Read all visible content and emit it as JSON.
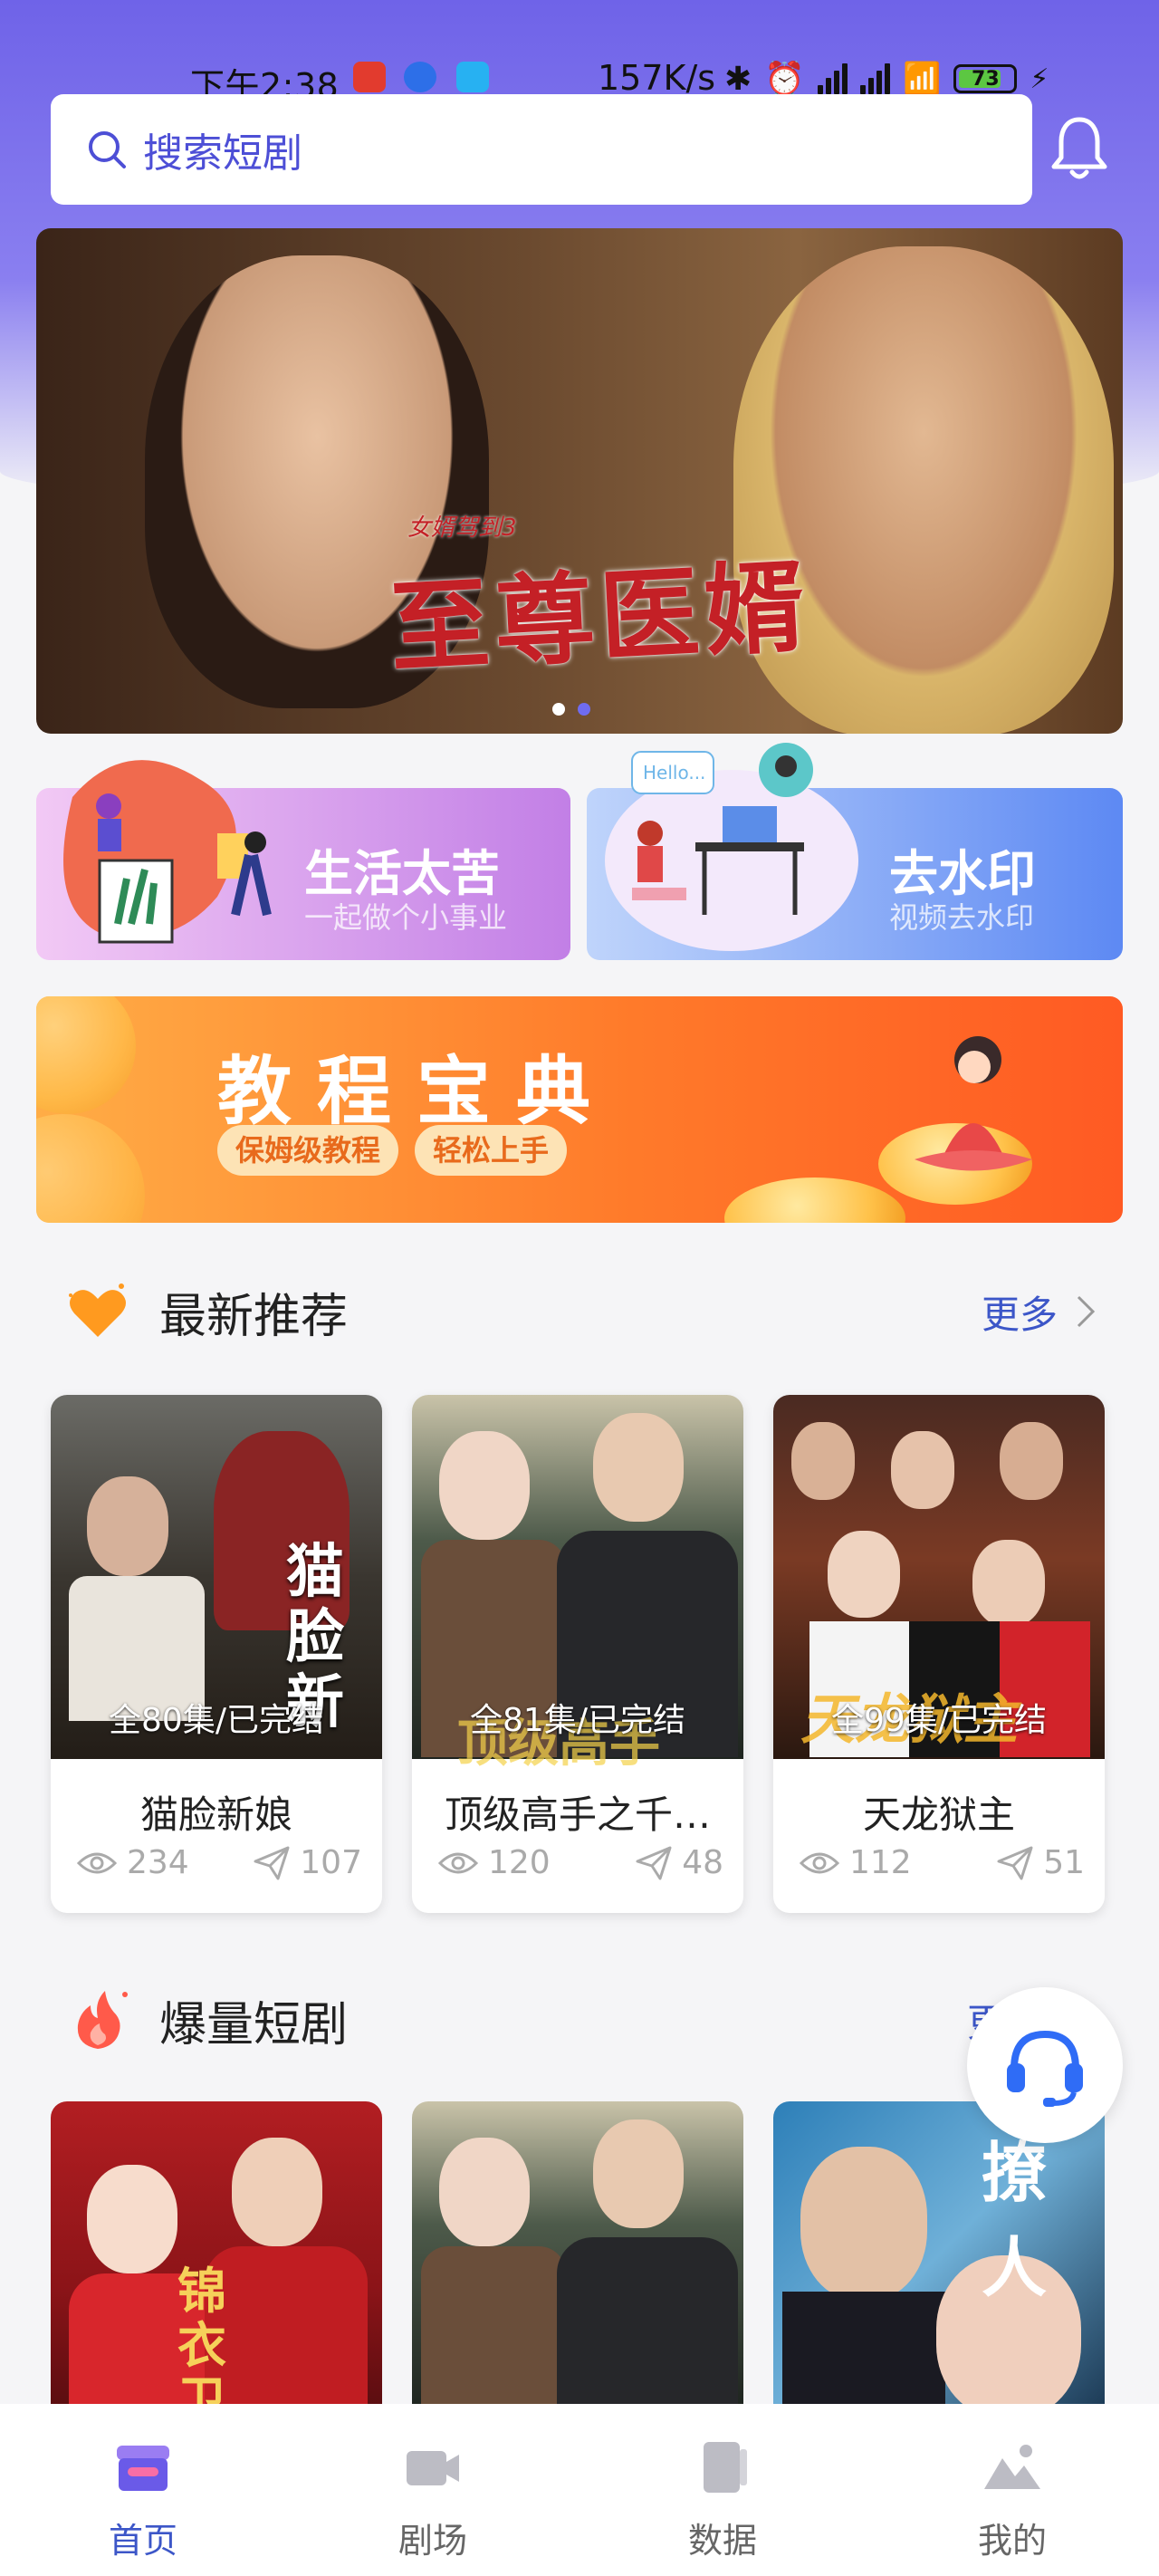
{
  "status_bar": {
    "time": "下午2:38",
    "net_speed": "157K/s",
    "battery": "73"
  },
  "search": {
    "placeholder": "搜索短剧"
  },
  "banner": {
    "title": "至尊医婿",
    "subtitle": "女婿驾到3",
    "active_dot": 1,
    "dot_count": 2
  },
  "features": [
    {
      "title": "生活太苦",
      "subtitle": "一起做个小事业"
    },
    {
      "title": "去水印",
      "subtitle": "视频去水印",
      "bubble": "Hello..."
    }
  ],
  "tutorial": {
    "title": "教程宝典",
    "tags": [
      "保姆级教程",
      "轻松上手"
    ]
  },
  "sections": {
    "latest": {
      "title": "最新推荐",
      "more": "更多"
    },
    "hot": {
      "title": "爆量短剧",
      "more": "更"
    }
  },
  "latest_dramas": [
    {
      "name": "猫脸新娘",
      "episodes": "全80集/已完结",
      "views": "234",
      "shares": "107",
      "poster_text": "猫脸新"
    },
    {
      "name": "顶级高手之千…",
      "episodes": "全81集/已完结",
      "views": "120",
      "shares": "48",
      "poster_text": "顶级高手"
    },
    {
      "name": "天龙狱主",
      "episodes": "全99集/已完结",
      "views": "112",
      "shares": "51",
      "poster_text": "天龙狱主"
    }
  ],
  "hot_dramas": [
    {
      "poster_text": "锦衣卫大人替嫁新"
    },
    {
      "poster_text": ""
    },
    {
      "poster_text": "撩人"
    }
  ],
  "tabs": [
    {
      "label": "首页",
      "active": true
    },
    {
      "label": "剧场",
      "active": false
    },
    {
      "label": "数据",
      "active": false
    },
    {
      "label": "我的",
      "active": false
    }
  ],
  "colors": {
    "accent": "#3c56c8",
    "header_purple": "#6f63e8",
    "orange": "#ff7a2a"
  }
}
